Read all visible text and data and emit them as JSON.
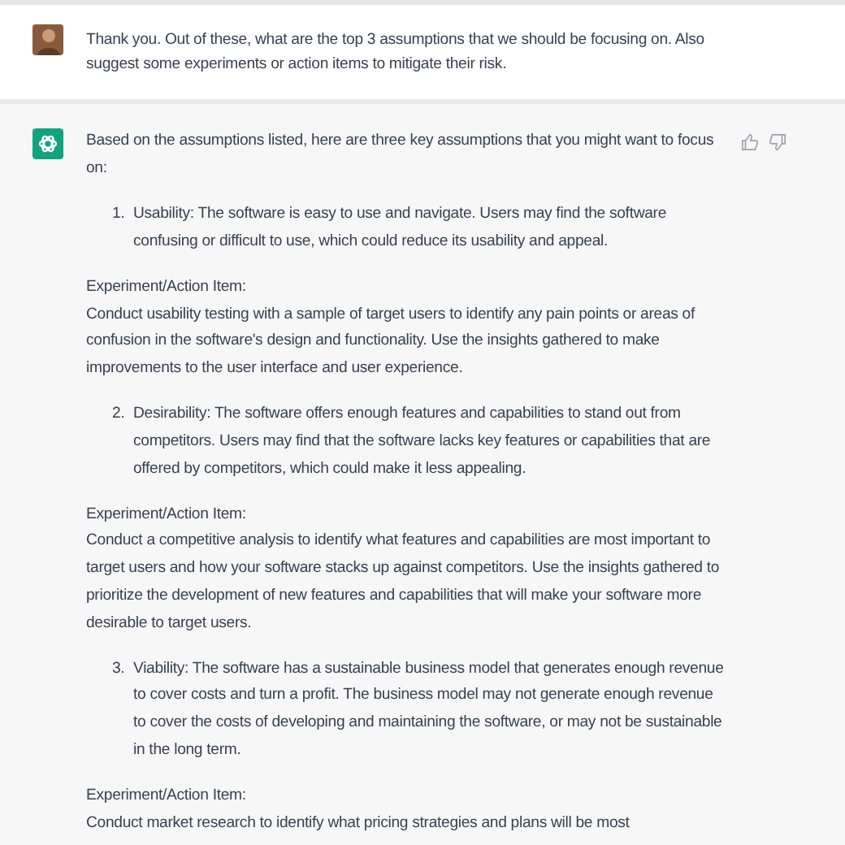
{
  "user_message": {
    "text": "Thank you. Out of these, what are the top 3 assumptions that we should be focusing on. Also suggest some experiments or action items to mitigate their risk."
  },
  "response": {
    "blocks": [
      {
        "kind": "paragraph",
        "text": "Based on the assumptions listed, here are three key assumptions that you might want to focus on:"
      },
      {
        "kind": "item",
        "number": "1.",
        "text": "Usability: The software is easy to use and navigate. Users may find the software confusing or difficult to use, which could reduce its usability and appeal."
      },
      {
        "kind": "action",
        "heading": "Experiment/Action Item:",
        "text": "Conduct usability testing with a sample of target users to identify any pain points or areas of confusion in the software's design and functionality. Use the insights gathered to make improvements to the user interface and user experience."
      },
      {
        "kind": "item",
        "number": "2.",
        "text": "Desirability: The software offers enough features and capabilities to stand out from competitors. Users may find that the software lacks key features or capabilities that are offered by competitors, which could make it less appealing."
      },
      {
        "kind": "action",
        "heading": "Experiment/Action Item:",
        "text": "Conduct a competitive analysis to identify what features and capabilities are most important to target users and how your software stacks up against competitors. Use the insights gathered to prioritize the development of new features and capabilities that will make your software more desirable to target users."
      },
      {
        "kind": "item",
        "number": "3.",
        "text": "Viability: The software has a sustainable business model that generates enough revenue to cover costs and turn a profit. The business model may not generate enough revenue to cover the costs of developing and maintaining the software, or may not be sustainable in the long term."
      },
      {
        "kind": "action",
        "heading": "Experiment/Action Item:",
        "text": "Conduct market research to identify what pricing strategies and plans will be most"
      }
    ]
  }
}
